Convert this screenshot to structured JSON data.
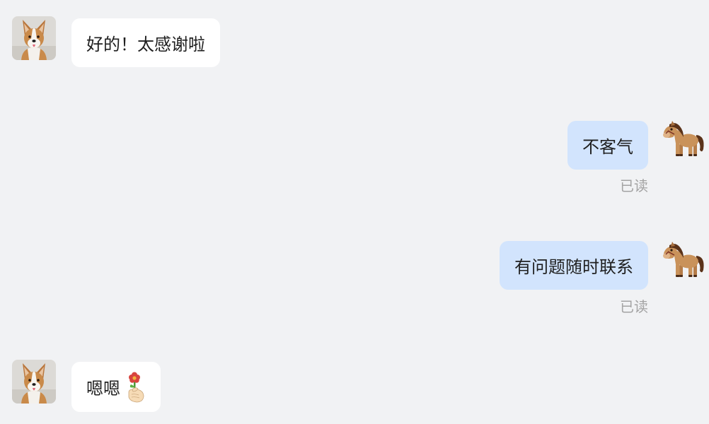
{
  "messages": [
    {
      "direction": "incoming",
      "avatar": "corgi-avatar",
      "text": "好的！太感谢啦"
    },
    {
      "direction": "outgoing",
      "avatar": "horse-avatar",
      "text": "不客气",
      "status": "已读"
    },
    {
      "direction": "outgoing",
      "avatar": "horse-avatar",
      "text": "有问题随时联系",
      "status": "已读"
    },
    {
      "direction": "incoming",
      "avatar": "corgi-avatar",
      "text": "嗯嗯",
      "emoji": "hand-holding-flower-icon"
    }
  ],
  "colors": {
    "background": "#f1f2f4",
    "incoming_bubble": "#ffffff",
    "outgoing_bubble": "#d2e4fd",
    "text": "#1f1f1f",
    "status_text": "#a3a3a3"
  }
}
